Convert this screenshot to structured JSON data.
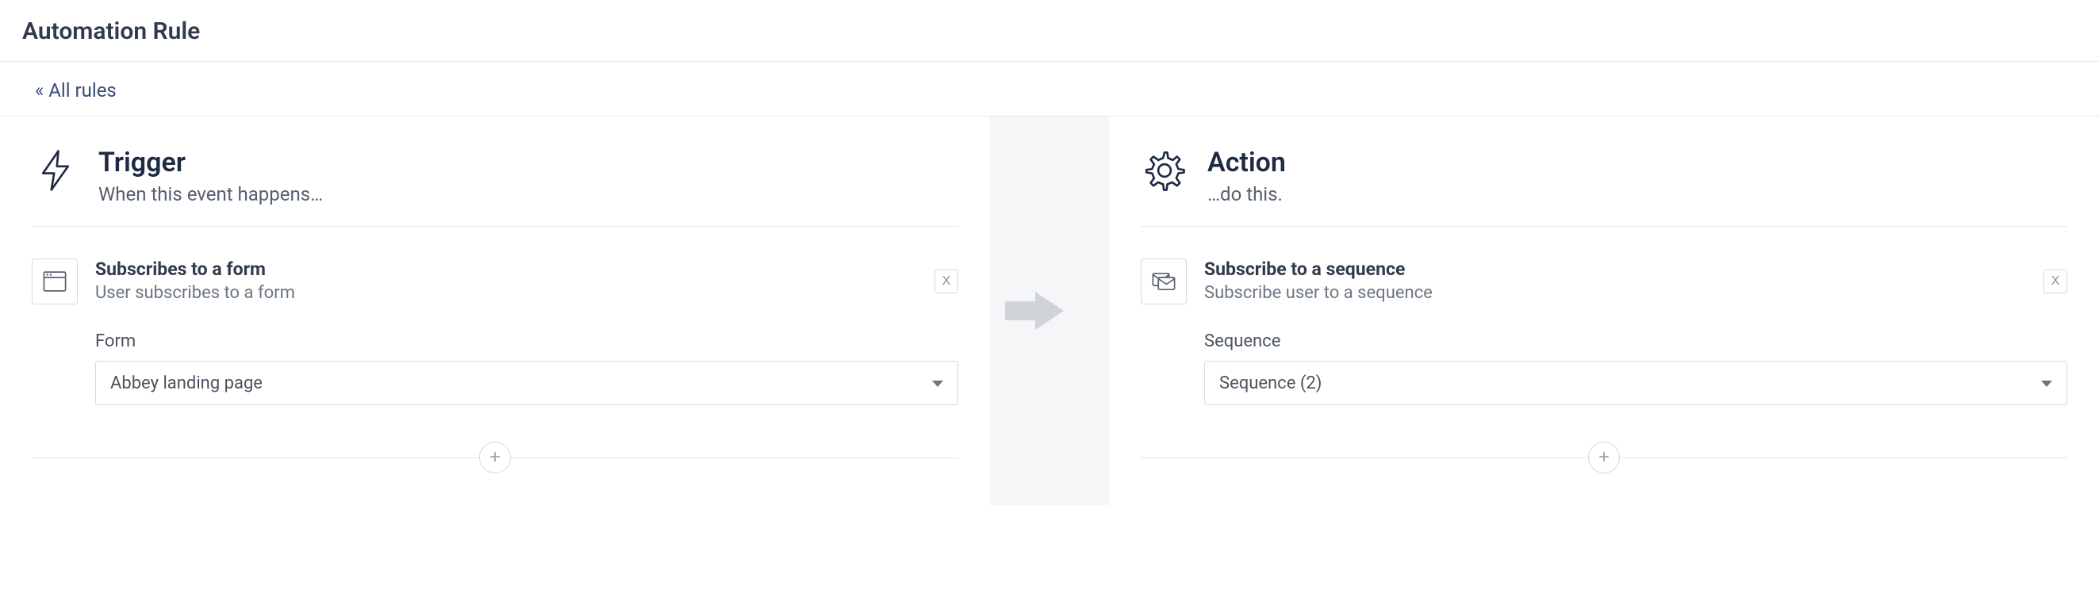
{
  "page": {
    "title": "Automation Rule",
    "breadcrumb": "« All rules"
  },
  "trigger": {
    "heading": "Trigger",
    "subheading": "When this event happens…",
    "card": {
      "title": "Subscribes to a form",
      "subtitle": "User subscribes to a form",
      "remove_label": "X",
      "field_label": "Form",
      "selected_value": "Abbey landing page"
    },
    "add_label": "+"
  },
  "action": {
    "heading": "Action",
    "subheading": "…do this.",
    "card": {
      "title": "Subscribe to a sequence",
      "subtitle": "Subscribe user to a sequence",
      "remove_label": "X",
      "field_label": "Sequence",
      "selected_value": "Sequence (2)"
    },
    "add_label": "+"
  }
}
